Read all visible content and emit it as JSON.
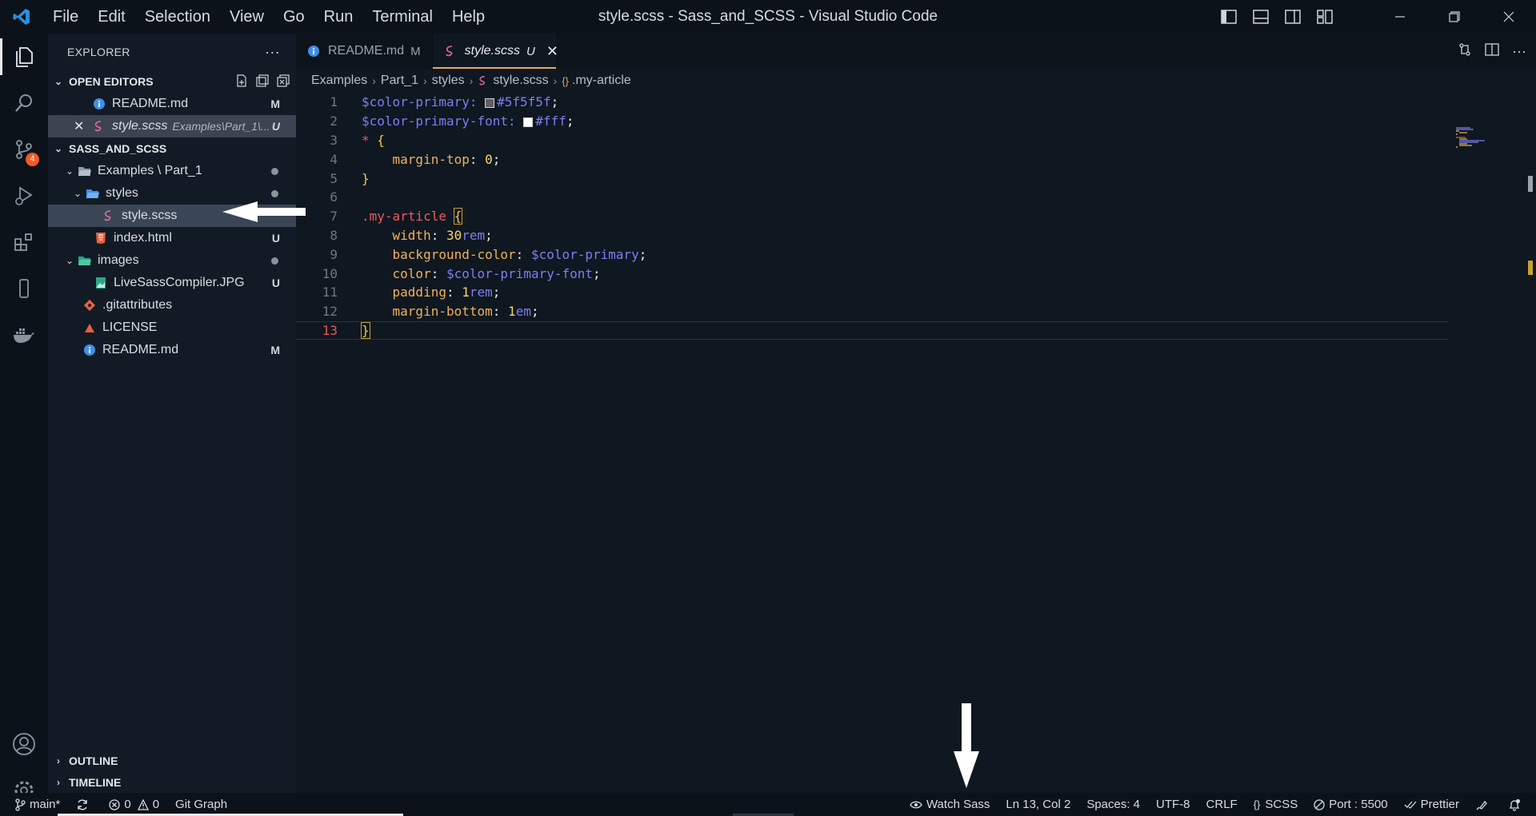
{
  "window": {
    "title": "style.scss - Sass_and_SCSS - Visual Studio Code",
    "menu": [
      "File",
      "Edit",
      "Selection",
      "View",
      "Go",
      "Run",
      "Terminal",
      "Help"
    ]
  },
  "activity": {
    "scm_badge": "4"
  },
  "sidebar": {
    "title": "EXPLORER",
    "more": "···",
    "open_editors": {
      "header": "OPEN EDITORS",
      "items": [
        {
          "name": "README.md",
          "status": "M"
        },
        {
          "name": "style.scss",
          "desc": "Examples\\Part_1\\...",
          "status": "U"
        }
      ]
    },
    "folder": {
      "header": "SASS_AND_SCSS",
      "items": [
        {
          "name": "Examples \\ Part_1"
        },
        {
          "name": "styles"
        },
        {
          "name": "style.scss"
        },
        {
          "name": "index.html",
          "status": "U"
        },
        {
          "name": "images"
        },
        {
          "name": "LiveSassCompiler.JPG",
          "status": "U"
        },
        {
          "name": ".gitattributes"
        },
        {
          "name": "LICENSE"
        },
        {
          "name": "README.md",
          "status": "M"
        }
      ]
    },
    "outline": "OUTLINE",
    "timeline": "TIMELINE"
  },
  "editor": {
    "tabs": [
      {
        "label": "README.md",
        "mark": "M"
      },
      {
        "label": "style.scss",
        "mark": "U",
        "close": "✕"
      }
    ],
    "breadcrumb": [
      "Examples",
      "Part_1",
      "styles",
      "style.scss",
      ".my-article"
    ],
    "line_numbers": [
      "1",
      "2",
      "3",
      "4",
      "5",
      "6",
      "7",
      "8",
      "9",
      "10",
      "11",
      "12",
      "13"
    ],
    "current_line": "13",
    "code": {
      "l1_var": "$color-primary:",
      "l1_val": "#5f5f5f",
      "l2_var": "$color-primary-font:",
      "l2_val": "#fff",
      "l3_sel": "*",
      "l4_prop": "margin-top",
      "l4_val": "0",
      "l7_sel": ".my-article",
      "l8_prop": "width",
      "l8_num": "30",
      "l8_unit": "rem",
      "l9_prop": "background-color",
      "l9_val": "$color-primary",
      "l10_prop": "color",
      "l10_val": "$color-primary-font",
      "l11_prop": "padding",
      "l11_num": "1",
      "l11_unit": "rem",
      "l12_prop": "margin-bottom",
      "l12_num": "1",
      "l12_unit": "em",
      "open_brace": "{",
      "close_brace": "}",
      "colon": ":",
      "semi": ";"
    }
  },
  "statusbar": {
    "branch": "main*",
    "errors": "0",
    "warnings": "0",
    "git_graph": "Git Graph",
    "watch_sass": "Watch Sass",
    "position": "Ln 13, Col 2",
    "spaces": "Spaces: 4",
    "encoding": "UTF-8",
    "eol": "CRLF",
    "language": "SCSS",
    "port": "Port : 5500",
    "prettier": "Prettier"
  },
  "colors": {
    "background": "#0f1720",
    "accent_tab": "#f0a35b",
    "badge": "#f15a2a"
  }
}
